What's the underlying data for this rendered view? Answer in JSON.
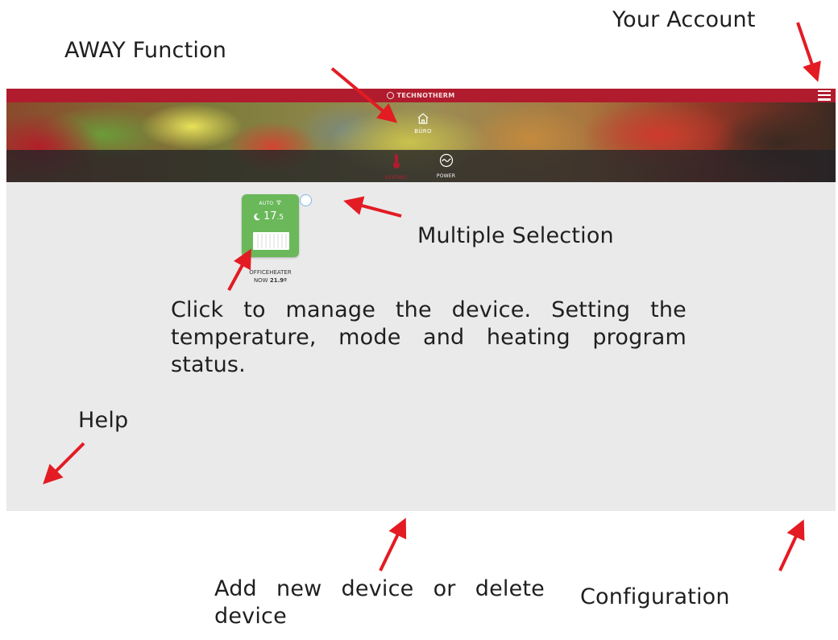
{
  "callouts": {
    "account": "Your Account",
    "away": "AWAY Function",
    "multiple": "Multiple Selection",
    "click": "Click to manage the device. Setting the temperature, mode and heating program status.",
    "help": "Help",
    "add": "Add new device or delete device",
    "config": "Configuration"
  },
  "app": {
    "brand": "TECHNOTHERM",
    "menu_icon": "hamburger-menu-icon",
    "home": {
      "label": "BÜRO",
      "icon": "home-icon"
    },
    "tabs": [
      {
        "label": "HEATING",
        "icon": "thermometer-icon",
        "active": true
      },
      {
        "label": "POWER",
        "icon": "power-wave-icon",
        "active": false
      }
    ],
    "device": {
      "mode": "AUTO",
      "wifi_icon": "wifi-icon",
      "mode_icon": "moon-icon",
      "setpoint_int": "17",
      "setpoint_dec": ".5",
      "name": "OFFICEHEATER",
      "now_label": "NOW",
      "now_value": "21.9º"
    }
  },
  "colors": {
    "brand_red": "#b01c2e",
    "card_green": "#6ab85a",
    "background": "#eaeaea",
    "arrow": "#e31b23"
  }
}
